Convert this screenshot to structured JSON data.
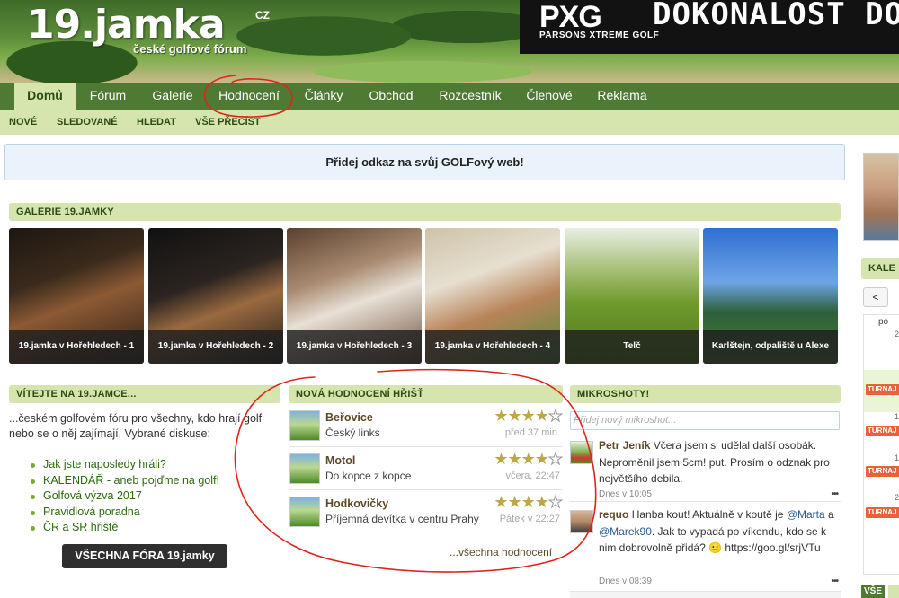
{
  "header": {
    "logo_main": "19.jamka",
    "logo_cz": "CZ",
    "logo_sub": "české golfové fórum"
  },
  "ad": {
    "brand": "PXG",
    "brand_sub": "PARSONS XTREME GOLF",
    "slogan": "DOKONALOST DORA"
  },
  "nav": {
    "items": [
      "Domů",
      "Fórum",
      "Galerie",
      "Hodnocení",
      "Články",
      "Obchod",
      "Rozcestník",
      "Členové",
      "Reklama"
    ],
    "active": "Domů"
  },
  "subnav": {
    "items": [
      "NOVÉ",
      "SLEDOVANÉ",
      "HLEDAT",
      "VŠE PŘEČÍST"
    ]
  },
  "link_banner": "Přidej odkaz na svůj GOLFový web!",
  "gallery": {
    "title": "GALERIE 19.JAMKY",
    "items": [
      "19.jamka v Hořehledech - 1",
      "19.jamka v Hořehledech - 2",
      "19.jamka v Hořehledech - 3",
      "19.jamka v Hořehledech - 4",
      "Telč",
      "Karlštejn, odpaliště u Alexe"
    ]
  },
  "welcome": {
    "title": "VÍTEJTE NA 19.JAMCE...",
    "intro": "...českém golfovém fóru pro všechny, kdo hrají golf nebo se o něj zajímají. Vybrané diskuse:",
    "links": [
      "Jak jste naposledy hráli?",
      "KALENDÁŘ - aneb pojďme na golf!",
      "Golfová výzva 2017",
      "Pravidlová poradna",
      "ČR a SR hřiště"
    ],
    "button": "VŠECHNA FÓRA 19.jamky"
  },
  "ratings": {
    "title": "NOVÁ HODNOCENÍ HŘIŠŤ",
    "items": [
      {
        "name": "Beřovice",
        "desc": "Český links",
        "time": "před 37 min.",
        "stars": 4
      },
      {
        "name": "Motol",
        "desc": "Do kopce z kopce",
        "time": "včera, 22:47",
        "stars": 4
      },
      {
        "name": "Hodkovičky",
        "desc": "Příjemná devítka v centru Prahy",
        "time": "Pátek v 22:27",
        "stars": 4
      }
    ],
    "all_link": "...všechna hodnocení"
  },
  "micro": {
    "title": "MIKROSHOTY!",
    "placeholder": "Přidej nový mikroshot...",
    "posts": [
      {
        "author": "Petr Jeník",
        "text": "Včera jsem si udělal další osobák. Neproměnil jsem 5cm! put. Prosím o odznak pro největšího debila.",
        "meta": "Dnes v 10:05"
      },
      {
        "author": "requo",
        "text_a": "Hanba kout! Aktuálně v koutě je",
        "mention1": "@Marta",
        "text_b": "a",
        "mention2": "@Marek90",
        "text_c": ". Jak to vypadá po víkendu, kdo se k nim dobrovolně přidá? 😐",
        "link": "https://goo.gl/srjVTu",
        "meta": "Dnes v 08:39"
      }
    ],
    "more": "•••"
  },
  "sidebar": {
    "head": "KALE",
    "prev": "<",
    "dayname": "po",
    "badge": "TURNAJ",
    "nums": [
      "2",
      "1",
      "1",
      "2"
    ],
    "all": "VŠE"
  },
  "colors": {
    "nav_bg": "#4e7a33",
    "section_bg": "#d5e5ad",
    "link_green": "#2c6b0c",
    "star_gold": "#bba84b",
    "annotation_red": "#e0241b"
  }
}
